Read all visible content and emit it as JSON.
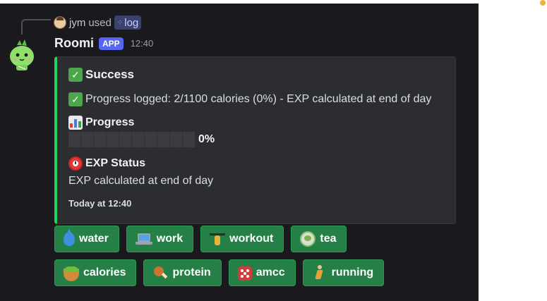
{
  "reply": {
    "user": "jym",
    "used_text": "used",
    "command": "log"
  },
  "message": {
    "bot_name": "Roomi",
    "badge": "APP",
    "time": "12:40"
  },
  "embed": {
    "accent_color": "#23d160",
    "title": "Success",
    "description": "Progress logged: 2/1100 calories (0%) - EXP calculated at end of day",
    "progress_label": "Progress",
    "progress_percent_text": "0%",
    "progress_fraction": 0.0,
    "exp_label": "EXP Status",
    "exp_value": "EXP calculated at end of day",
    "footer": "Today at 12:40"
  },
  "buttons_row1": [
    {
      "label": "water",
      "icon": "water-drop-icon"
    },
    {
      "label": "work",
      "icon": "laptop-icon"
    },
    {
      "label": "workout",
      "icon": "weight-lifter-icon"
    },
    {
      "label": "tea",
      "icon": "tea-icon"
    }
  ],
  "buttons_row2": [
    {
      "label": "calories",
      "icon": "salad-icon"
    },
    {
      "label": "protein",
      "icon": "drumstick-icon"
    },
    {
      "label": "amcc",
      "icon": "dice-icon"
    },
    {
      "label": "running",
      "icon": "runner-icon"
    }
  ],
  "colors": {
    "button_green": "#248046",
    "app_badge": "#5865f2",
    "background": "#1a1a1e"
  }
}
